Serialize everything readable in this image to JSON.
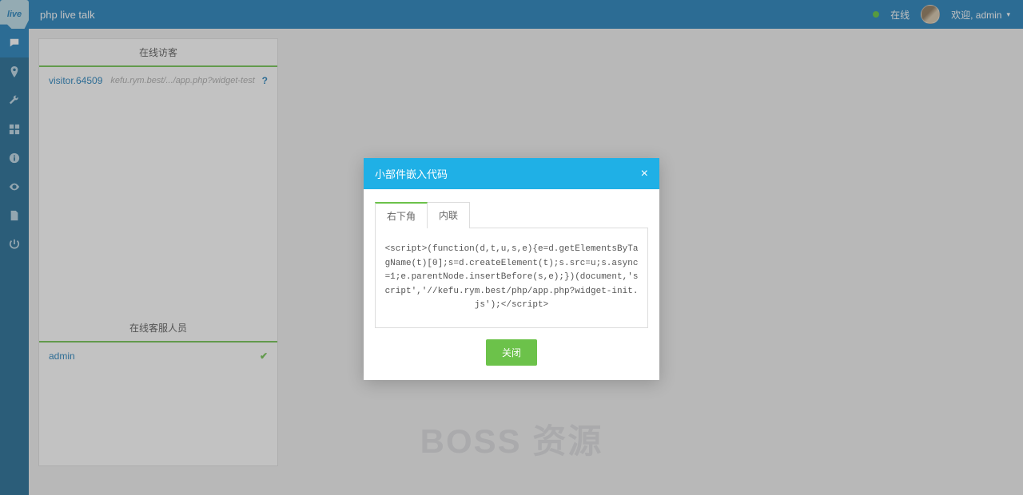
{
  "header": {
    "logo_text": "live",
    "app_title": "php live talk",
    "status_text": "在线",
    "welcome_text": "欢迎, admin"
  },
  "sidebar": {
    "items": [
      {
        "name": "chat-icon"
      },
      {
        "name": "location-icon"
      },
      {
        "name": "wrench-icon"
      },
      {
        "name": "grid-icon"
      },
      {
        "name": "info-icon"
      },
      {
        "name": "eye-icon"
      },
      {
        "name": "file-icon"
      },
      {
        "name": "power-icon"
      }
    ]
  },
  "panels": {
    "visitors": {
      "title": "在线访客",
      "rows": [
        {
          "name": "visitor.64509",
          "url": "kefu.rym.best/.../app.php?widget-test"
        }
      ]
    },
    "agents": {
      "title": "在线客服人员",
      "rows": [
        {
          "name": "admin"
        }
      ]
    }
  },
  "modal": {
    "title": "小部件嵌入代码",
    "tabs": [
      "右下角",
      "内联"
    ],
    "code": "<script>(function(d,t,u,s,e){e=d.getElementsByTagName(t)[0];s=d.createElement(t);s.src=u;s.async=1;e.parentNode.insertBefore(s,e);})(document,'script','//kefu.rym.best/php/app.php?widget-init.js');</script>",
    "close_btn": "关闭"
  },
  "watermark": "BOSS 资源"
}
